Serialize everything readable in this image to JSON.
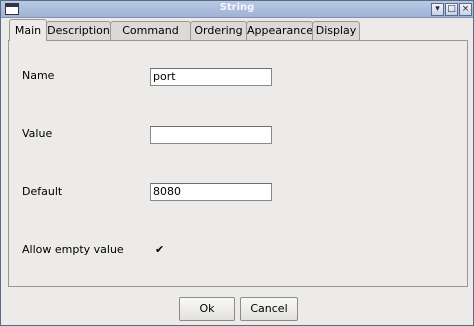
{
  "window": {
    "title": "String",
    "min_glyph": "▾",
    "max_glyph": "□",
    "close_glyph": "×"
  },
  "tabs": [
    {
      "label": "Main",
      "active": true
    },
    {
      "label": "Description",
      "active": false
    },
    {
      "label": "Command line",
      "active": false
    },
    {
      "label": "Ordering",
      "active": false
    },
    {
      "label": "Appearance",
      "active": false
    },
    {
      "label": "Display",
      "active": false
    }
  ],
  "form": {
    "name_label": "Name",
    "name_value": "port",
    "value_label": "Value",
    "value_value": "",
    "default_label": "Default",
    "default_value": "8080",
    "allow_empty_label": "Allow empty value",
    "allow_empty_checked": true,
    "check_glyph": "✔"
  },
  "buttons": {
    "ok": "Ok",
    "cancel": "Cancel"
  }
}
